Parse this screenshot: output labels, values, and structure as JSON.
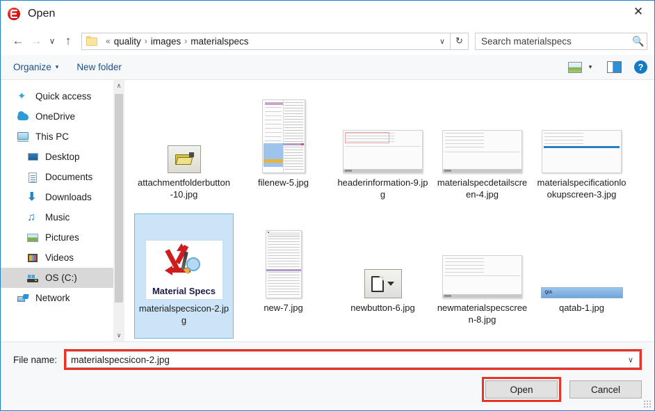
{
  "window": {
    "title": "Open",
    "app_icon": "epicor-logo-icon",
    "close_label": "✕"
  },
  "navigation": {
    "back": "←",
    "forward": "→",
    "recent": "∨",
    "up": "↑",
    "refresh": "↻",
    "dropdown": "∨"
  },
  "breadcrumb": {
    "overflow": "«",
    "separator": "›",
    "items": [
      "quality",
      "images",
      "materialspecs"
    ]
  },
  "search": {
    "placeholder": "Search materialspecs",
    "value": "",
    "icon": "search-icon"
  },
  "toolbar": {
    "organize_label": "Organize",
    "organize_caret": "▾",
    "new_folder_label": "New folder",
    "view_caret": "▾",
    "help_label": "?"
  },
  "sidebar": {
    "items": [
      {
        "label": "Quick access",
        "icon": "star-icon",
        "indent": false,
        "selected": false
      },
      {
        "label": "OneDrive",
        "icon": "cloud-icon",
        "indent": false,
        "selected": false
      },
      {
        "label": "This PC",
        "icon": "computer-icon",
        "indent": false,
        "selected": false
      },
      {
        "label": "Desktop",
        "icon": "desktop-icon",
        "indent": true,
        "selected": false
      },
      {
        "label": "Documents",
        "icon": "documents-icon",
        "indent": true,
        "selected": false
      },
      {
        "label": "Downloads",
        "icon": "downloads-icon",
        "indent": true,
        "selected": false
      },
      {
        "label": "Music",
        "icon": "music-icon",
        "indent": true,
        "selected": false
      },
      {
        "label": "Pictures",
        "icon": "pictures-icon",
        "indent": true,
        "selected": false
      },
      {
        "label": "Videos",
        "icon": "videos-icon",
        "indent": true,
        "selected": false
      },
      {
        "label": "OS (C:)",
        "icon": "drive-icon",
        "indent": true,
        "selected": true
      },
      {
        "label": "Network",
        "icon": "network-icon",
        "indent": false,
        "selected": false
      }
    ],
    "scroll_up": "∧",
    "scroll_down": "∨"
  },
  "files": {
    "rows": [
      [
        {
          "name": "attachmentfolderbutton-10.jpg",
          "thumb": "folder-button-thumb",
          "selected": false
        },
        {
          "name": "filenew-5.jpg",
          "thumb": "document-list-thumb",
          "selected": false
        },
        {
          "name": "headerinformation-9.jpg",
          "thumb": "screen-header-thumb",
          "selected": false
        },
        {
          "name": "materialspecdetailscreen-4.jpg",
          "thumb": "screen-detail-thumb",
          "selected": false
        },
        {
          "name": "materialspecificationlookupscreen-3.jpg",
          "thumb": "screen-lookup-thumb",
          "selected": false
        }
      ],
      [
        {
          "name": "materialspecsicon-2.jpg",
          "thumb": "material-specs-icon-thumb",
          "caption": "Material Specs",
          "selected": true
        },
        {
          "name": "new-7.jpg",
          "thumb": "document-narrow-thumb",
          "selected": false
        },
        {
          "name": "newbutton-6.jpg",
          "thumb": "new-button-thumb",
          "selected": false
        },
        {
          "name": "newmaterialspecscreen-8.jpg",
          "thumb": "screen-new-thumb",
          "selected": false
        },
        {
          "name": "qatab-1.jpg",
          "thumb": "qa-tab-thumb",
          "tab_label": "Q/A",
          "selected": false
        }
      ]
    ]
  },
  "footer": {
    "filename_label": "File name:",
    "filename_value": "materialspecsicon-2.jpg",
    "filename_caret": "∨",
    "open_label": "Open",
    "cancel_label": "Cancel"
  },
  "annotations": {
    "highlight_color": "#ed3124",
    "targets": [
      "file-name-field",
      "open-button"
    ]
  }
}
